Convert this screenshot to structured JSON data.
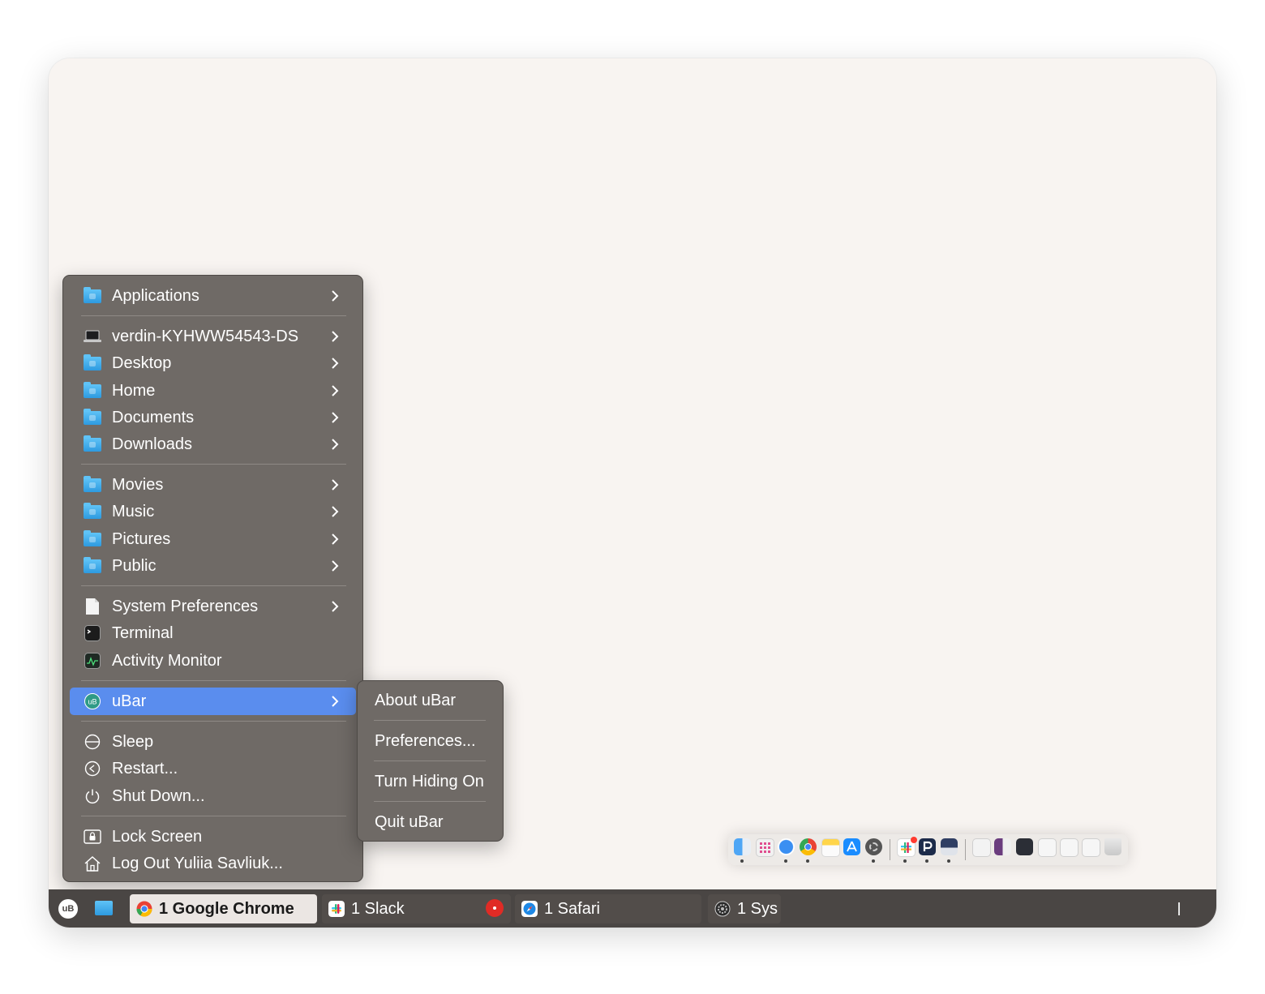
{
  "menu": {
    "items": [
      {
        "label": "Applications",
        "icon": "applications-folder-icon"
      },
      {
        "label": "verdin-KYHWW54543-DS",
        "icon": "laptop-icon"
      },
      {
        "label": "Desktop",
        "icon": "desktop-folder-icon"
      },
      {
        "label": "Home",
        "icon": "home-folder-icon"
      },
      {
        "label": "Documents",
        "icon": "documents-folder-icon"
      },
      {
        "label": "Downloads",
        "icon": "downloads-folder-icon"
      },
      {
        "label": "Movies",
        "icon": "movies-folder-icon"
      },
      {
        "label": "Music",
        "icon": "music-folder-icon"
      },
      {
        "label": "Pictures",
        "icon": "pictures-folder-icon"
      },
      {
        "label": "Public",
        "icon": "public-folder-icon"
      },
      {
        "label": "System Preferences",
        "icon": "file-icon"
      },
      {
        "label": "Terminal",
        "icon": "terminal-icon"
      },
      {
        "label": "Activity Monitor",
        "icon": "activity-monitor-icon"
      },
      {
        "label": "uBar",
        "icon": "ubar-icon",
        "selected": true
      },
      {
        "label": "Sleep",
        "icon": "sleep-icon"
      },
      {
        "label": "Restart...",
        "icon": "restart-icon"
      },
      {
        "label": "Shut Down...",
        "icon": "power-icon"
      },
      {
        "label": "Lock Screen",
        "icon": "lock-icon"
      },
      {
        "label": "Log Out Yuliia Savliuk...",
        "icon": "house-icon"
      }
    ]
  },
  "submenu": {
    "about": "About uBar",
    "preferences": "Preferences...",
    "hiding": "Turn Hiding On",
    "quit": "Quit uBar"
  },
  "taskbar": {
    "logo": "uB",
    "items": [
      {
        "label": "1 Google Chrome",
        "icon": "chrome-icon",
        "active": true
      },
      {
        "label": "1 Slack",
        "icon": "slack-icon"
      },
      {
        "label": "1 Safari",
        "icon": "safari-icon"
      },
      {
        "label": "1 Sys",
        "icon": "system-preferences-icon"
      }
    ]
  },
  "colors": {
    "menu_bg": "#6f6a66",
    "selection": "#5a8dee",
    "bar_bg": "#4a4644",
    "desktop_bg": "#f8f4f1"
  }
}
